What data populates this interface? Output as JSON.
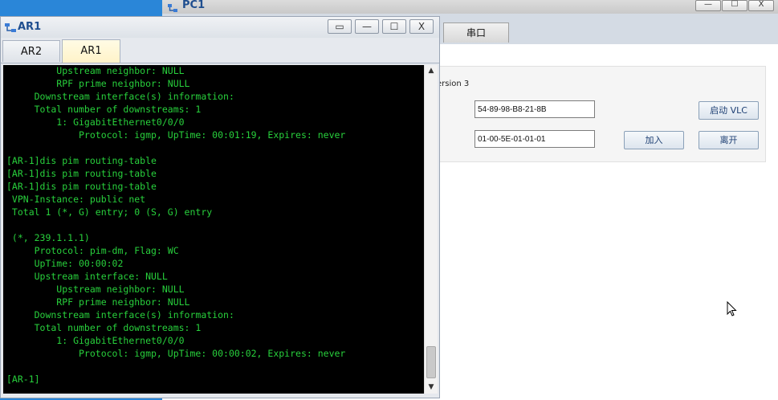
{
  "pc1_window": {
    "title": "PC1",
    "controls": {
      "minimize": "—",
      "maximize": "☐",
      "close": "X"
    },
    "tabs": {
      "serial": "串口"
    },
    "version_label": "ersion 3",
    "mac_value": "54-89-98-B8-21-8B",
    "group_value": "01-00-5E-01-01-01",
    "buttons": {
      "start_vlc": "启动 VLC",
      "join": "加入",
      "leave": "离开"
    }
  },
  "ar1_window": {
    "title": "AR1",
    "controls": {
      "restore": "▭",
      "minimize": "—",
      "maximize": "☐",
      "close": "X"
    },
    "tabs": [
      {
        "label": "AR2",
        "active": false
      },
      {
        "label": "AR1",
        "active": true
      }
    ],
    "console_lines": [
      "         Upstream neighbor: NULL",
      "         RPF prime neighbor: NULL",
      "     Downstream interface(s) information:",
      "     Total number of downstreams: 1",
      "         1: GigabitEthernet0/0/0",
      "             Protocol: igmp, UpTime: 00:01:19, Expires: never",
      "",
      "[AR-1]dis pim routing-table",
      "[AR-1]dis pim routing-table",
      "[AR-1]dis pim routing-table",
      " VPN-Instance: public net",
      " Total 1 (*, G) entry; 0 (S, G) entry",
      "",
      " (*, 239.1.1.1)",
      "     Protocol: pim-dm, Flag: WC",
      "     UpTime: 00:00:02",
      "     Upstream interface: NULL",
      "         Upstream neighbor: NULL",
      "         RPF prime neighbor: NULL",
      "     Downstream interface(s) information:",
      "     Total number of downstreams: 1",
      "         1: GigabitEthernet0/0/0",
      "             Protocol: igmp, UpTime: 00:00:02, Expires: never",
      "",
      "[AR-1]"
    ],
    "scrollbar": {
      "up": "▲",
      "down": "▼"
    }
  },
  "colors": {
    "console_text": "#28d03c",
    "console_bg": "#000000",
    "title_text": "#1f4e8f",
    "desktop": "#2a86d8"
  }
}
